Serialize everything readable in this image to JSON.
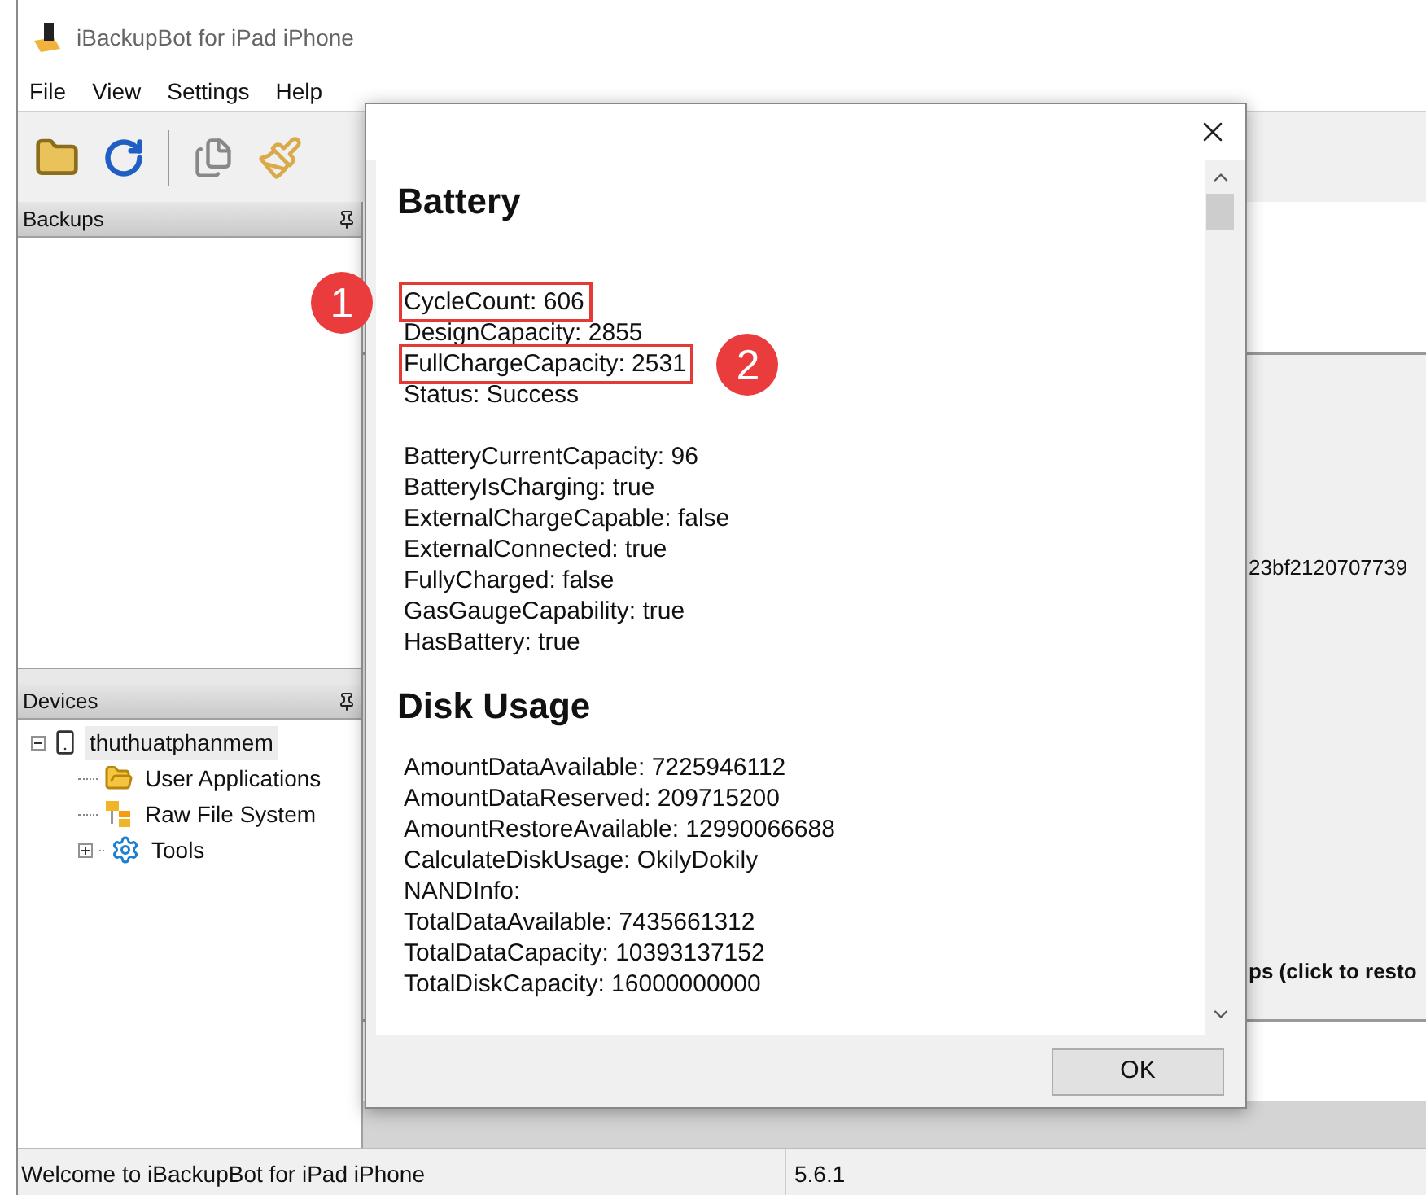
{
  "window": {
    "title": "iBackupBot for iPad iPhone"
  },
  "menu": [
    "File",
    "View",
    "Settings",
    "Help"
  ],
  "backups_panel": {
    "title": "Backups"
  },
  "devices_panel": {
    "title": "Devices",
    "tree": [
      {
        "label": "thuthuatphanmem",
        "kind": "device",
        "expanded": true,
        "selected": true,
        "children": [
          {
            "label": "User Applications",
            "kind": "folder",
            "selected": false
          },
          {
            "label": "Raw File System",
            "kind": "filesystem",
            "selected": false
          },
          {
            "label": "Tools",
            "kind": "tools",
            "expanded": false,
            "selected": false
          }
        ]
      }
    ]
  },
  "background_texts": [
    {
      "text": "23bf2120707739",
      "bold": false
    },
    {
      "text": "ps (click to resto",
      "bold": true
    }
  ],
  "dialog": {
    "sections": [
      {
        "title": "Battery",
        "groups": [
          [
            {
              "text": "CycleCount: 606",
              "highlighted": true,
              "marker_before": "1"
            },
            {
              "text": "DesignCapacity: 2855",
              "highlighted": false
            },
            {
              "text": "FullChargeCapacity: 2531",
              "highlighted": true,
              "marker_after": "2"
            },
            {
              "text": "Status: Success",
              "highlighted": false
            }
          ],
          [
            {
              "text": "BatteryCurrentCapacity: 96",
              "highlighted": false
            },
            {
              "text": "BatteryIsCharging: true",
              "highlighted": false
            },
            {
              "text": "ExternalChargeCapable: false",
              "highlighted": false
            },
            {
              "text": "ExternalConnected: true",
              "highlighted": false
            },
            {
              "text": "FullyCharged: false",
              "highlighted": false
            },
            {
              "text": "GasGaugeCapability: true",
              "highlighted": false
            },
            {
              "text": "HasBattery: true",
              "highlighted": false
            }
          ]
        ]
      },
      {
        "title": "Disk Usage",
        "groups": [
          [
            {
              "text": "AmountDataAvailable: 7225946112",
              "highlighted": false
            },
            {
              "text": "AmountDataReserved: 209715200",
              "highlighted": false
            },
            {
              "text": "AmountRestoreAvailable: 12990066688",
              "highlighted": false
            },
            {
              "text": "CalculateDiskUsage: OkilyDokily",
              "highlighted": false
            },
            {
              "text": "NANDInfo:",
              "highlighted": false
            },
            {
              "text": "TotalDataAvailable: 7435661312",
              "highlighted": false
            },
            {
              "text": "TotalDataCapacity: 10393137152",
              "highlighted": false
            },
            {
              "text": "TotalDiskCapacity: 16000000000",
              "highlighted": false
            }
          ]
        ]
      }
    ],
    "ok_button": "OK"
  },
  "status_bar": [
    "Welcome to iBackupBot for iPad iPhone",
    "5.6.1"
  ]
}
